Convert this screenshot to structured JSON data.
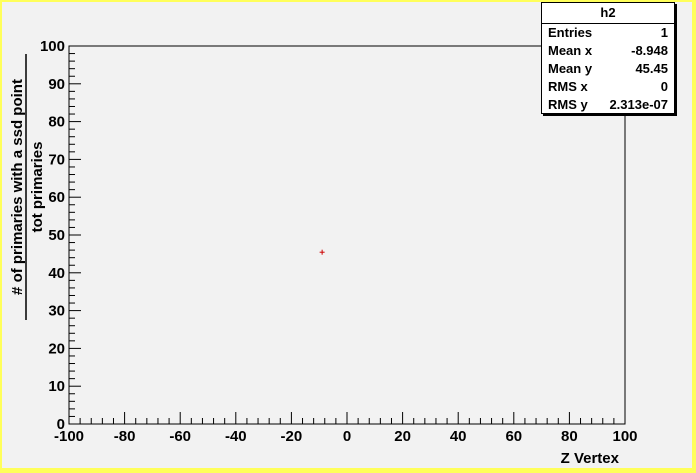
{
  "stats_box": {
    "title": "h2",
    "rows": [
      {
        "label": "Entries",
        "value": "1"
      },
      {
        "label": "Mean x",
        "value": "-8.948"
      },
      {
        "label": "Mean y",
        "value": "45.45"
      },
      {
        "label": "RMS x",
        "value": "0"
      },
      {
        "label": "RMS y",
        "value": "2.313e-07"
      }
    ]
  },
  "chart_data": {
    "type": "scatter",
    "title": "",
    "xlabel": "Z Vertex",
    "ylabel_numerator": "# of primaries with a ssd point",
    "ylabel_denominator": "tot primaries",
    "xlim": [
      -100,
      100
    ],
    "ylim": [
      0,
      100
    ],
    "x_ticks": [
      -100,
      -80,
      -60,
      -40,
      -20,
      0,
      20,
      40,
      60,
      80,
      100
    ],
    "y_ticks": [
      0,
      10,
      20,
      30,
      40,
      50,
      60,
      70,
      80,
      90,
      100
    ],
    "grid": false,
    "marker_color": "#cc0000",
    "points": [
      {
        "x": -8.948,
        "y": 45.45
      }
    ]
  },
  "colors": {
    "frame": "#ffff5a",
    "pad": "#f2f2f2",
    "marker": "#cc0000"
  }
}
